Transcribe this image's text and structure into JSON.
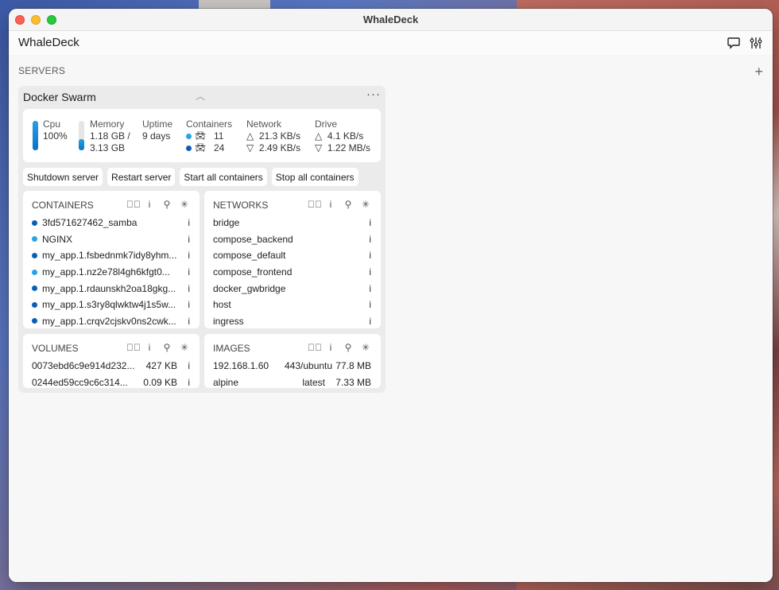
{
  "window": {
    "title": "WhaleDeck"
  },
  "app": {
    "name": "WhaleDeck",
    "icons": [
      "chat-icon",
      "sliders-icon"
    ]
  },
  "servers": {
    "header": "SERVERS",
    "add_icon": "plus-icon"
  },
  "server": {
    "name": "Docker Swarm",
    "stats": {
      "cpu": {
        "label": "Cpu",
        "value": "100%",
        "fill_fraction": 1.0
      },
      "memory": {
        "label": "Memory",
        "value": "1.18 GB /",
        "total": "3.13 GB",
        "fill_fraction": 0.38
      },
      "uptime": {
        "label": "Uptime",
        "value": "9 days"
      },
      "containers": {
        "label": "Containers",
        "running": "11",
        "total": "24",
        "running_color": "#29a3e6",
        "total_color": "#0a5fb5"
      },
      "network": {
        "label": "Network",
        "up": "21.3 KB/s",
        "down": "2.49 KB/s"
      },
      "drive": {
        "label": "Drive",
        "up": "4.1 KB/s",
        "down": "1.22 MB/s"
      }
    },
    "actions": [
      "Shutdown server",
      "Restart server",
      "Start all containers",
      "Stop all containers"
    ],
    "containers": {
      "title": "CONTAINERS",
      "items": [
        {
          "name": "3fd571627462_samba",
          "color": "#0a5fb5"
        },
        {
          "name": "NGINX",
          "color": "#29a3e6"
        },
        {
          "name": "my_app.1.fsbednmk7idy8yhm...",
          "color": "#0a5fb5"
        },
        {
          "name": "my_app.1.nz2e78l4gh6kfgt0...",
          "color": "#29a3e6"
        },
        {
          "name": "my_app.1.rdaunskh2oa18gkg...",
          "color": "#0a5fb5"
        },
        {
          "name": "my_app.1.s3ry8qlwktw4j1s5w...",
          "color": "#0a5fb5"
        },
        {
          "name": "my_app.1.crqv2cjskv0ns2cwk...",
          "color": "#0a5fb5"
        }
      ]
    },
    "networks": {
      "title": "NETWORKS",
      "items": [
        "bridge",
        "compose_backend",
        "compose_default",
        "compose_frontend",
        "docker_gwbridge",
        "host",
        "ingress"
      ]
    },
    "volumes": {
      "title": "VOLUMES",
      "items": [
        {
          "name": "0073ebd6c9e914d232...",
          "size": "427 KB"
        },
        {
          "name": "0244ed59cc9c6c314...",
          "size": "0.09 KB"
        }
      ]
    },
    "images": {
      "title": "IMAGES",
      "items": [
        {
          "name": "192.168.1.60",
          "tag": "443/ubuntu",
          "size": "77.8 MB"
        },
        {
          "name": "alpine",
          "tag": "latest",
          "size": "7.33 MB"
        }
      ]
    }
  }
}
